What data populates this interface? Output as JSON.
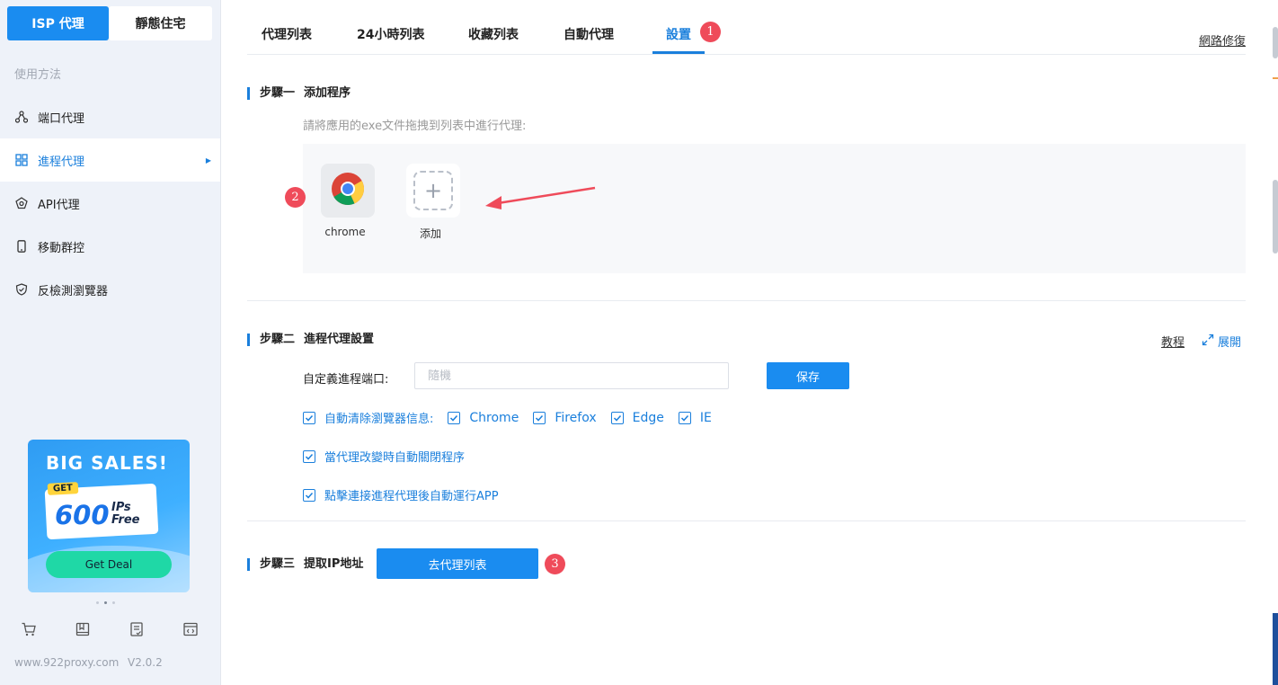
{
  "sidebar": {
    "segments": {
      "isp": "ISP 代理",
      "static": "靜態住宅"
    },
    "group_label": "使用方法",
    "items": [
      {
        "label": "端口代理",
        "icon": "network-icon"
      },
      {
        "label": "進程代理",
        "icon": "grid-icon"
      },
      {
        "label": "API代理",
        "icon": "api-icon"
      },
      {
        "label": "移動群控",
        "icon": "mobile-icon"
      },
      {
        "label": "反檢測瀏覽器",
        "icon": "shield-icon"
      }
    ],
    "active_item": "進程代理",
    "promo": {
      "title": "BIG SALES!",
      "get": "GET",
      "number": "600",
      "ips_line1": "IPs",
      "ips_line2": "Free",
      "button": "Get Deal"
    },
    "footer": {
      "site": "www.922proxy.com",
      "version": "V2.0.2"
    }
  },
  "tabs": [
    {
      "label": "代理列表"
    },
    {
      "label": "24小時列表"
    },
    {
      "label": "收藏列表"
    },
    {
      "label": "自動代理"
    },
    {
      "label": "設置"
    }
  ],
  "active_tab": "設置",
  "repair_link": "網路修復",
  "badges": {
    "one": "1",
    "two": "2",
    "three": "3"
  },
  "step1": {
    "step": "步驟一",
    "title": "添加程序",
    "hint": "請將應用的exe文件拖拽到列表中進行代理:",
    "apps": [
      {
        "label": "chrome",
        "icon": "chrome-icon"
      }
    ],
    "add_label": "添加"
  },
  "step2": {
    "step": "步驟二",
    "title": "進程代理設置",
    "tutorial_link": "教程",
    "expand_label": "展開",
    "port_label": "自定義進程端口:",
    "port_placeholder": "隨機",
    "save_button": "保存",
    "clear_label": "自動清除瀏覽器信息:",
    "browsers": [
      "Chrome",
      "Firefox",
      "Edge",
      "IE"
    ],
    "option_close": "當代理改變時自動關閉程序",
    "option_autorun": "點擊連接進程代理後自動運行APP"
  },
  "step3": {
    "step": "步驟三",
    "title": "提取IP地址",
    "button": "去代理列表"
  },
  "colors": {
    "accent": "#1a8cf0",
    "badge": "#ef4b5a",
    "sidebar_bg": "#eef2f9"
  }
}
